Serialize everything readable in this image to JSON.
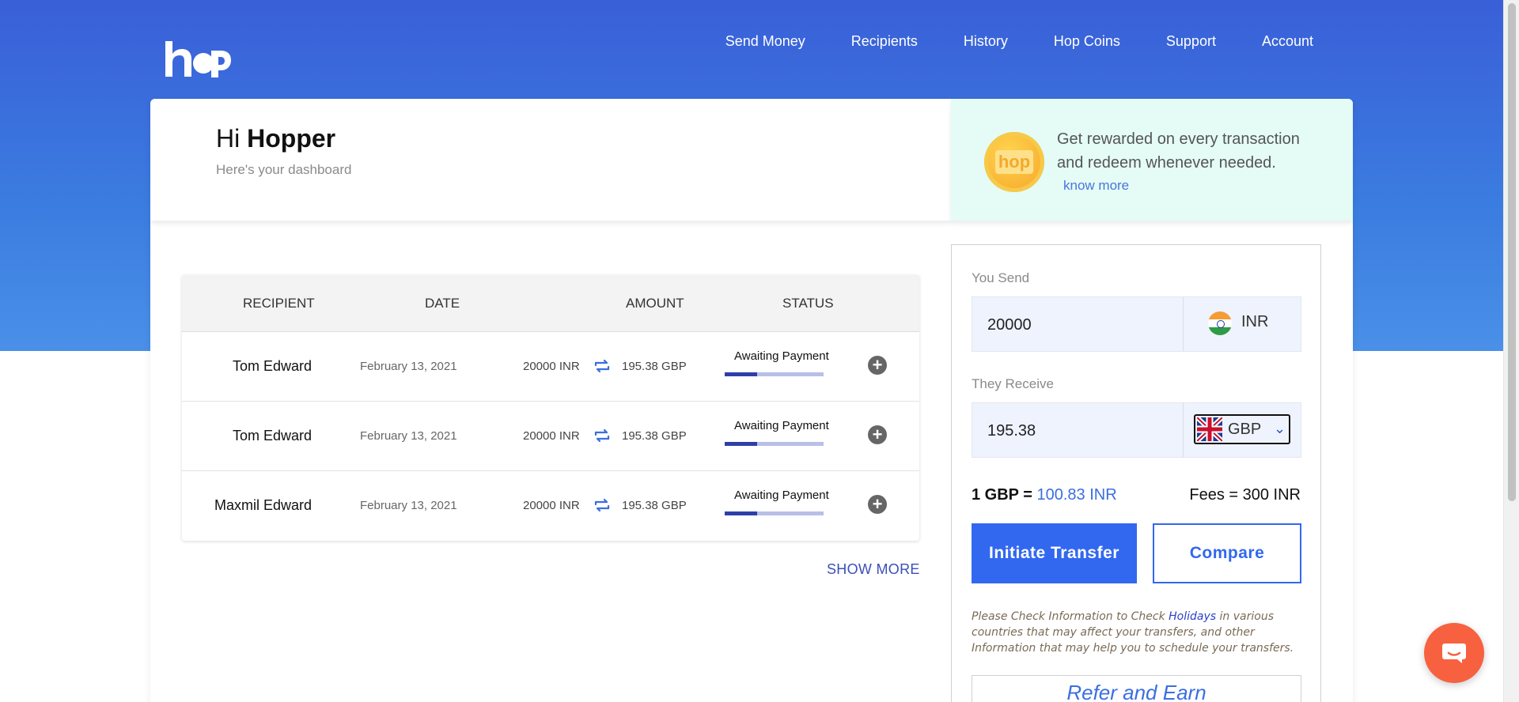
{
  "brand": {
    "logo_text": "hop"
  },
  "nav": {
    "items": [
      "Send Money",
      "Recipients",
      "History",
      "Hop Coins",
      "Support",
      "Account"
    ]
  },
  "greeting": {
    "hi": "Hi",
    "name": "Hopper",
    "subtitle": "Here's your dashboard"
  },
  "promo": {
    "coin_label": "hop",
    "text": "Get rewarded on every transaction and redeem whenever needed.",
    "link": "know more"
  },
  "table": {
    "headers": [
      "RECIPIENT",
      "DATE",
      "AMOUNT",
      "STATUS"
    ],
    "rows": [
      {
        "name": "Tom Edward",
        "date": "February 13, 2021",
        "send": "20000 INR",
        "receive": "195.38 GBP",
        "status": "Awaiting Payment",
        "progress": 0.33
      },
      {
        "name": "Tom Edward",
        "date": "February 13, 2021",
        "send": "20000 INR",
        "receive": "195.38 GBP",
        "status": "Awaiting Payment",
        "progress": 0.33
      },
      {
        "name": "Maxmil Edward",
        "date": "February 13, 2021",
        "send": "20000 INR",
        "receive": "195.38 GBP",
        "status": "Awaiting Payment",
        "progress": 0.33
      }
    ],
    "show_more": "SHOW MORE"
  },
  "calculator": {
    "send_label": "You Send",
    "send_value": "20000",
    "send_currency": "INR",
    "receive_label": "They Receive",
    "receive_value": "195.38",
    "receive_currency": "GBP",
    "rate_prefix": "1 GBP =",
    "rate_value": "100.83 INR",
    "fees": "Fees = 300 INR",
    "initiate_label": "Initiate Transfer",
    "compare_label": "Compare",
    "info_before": "Please Check Information to Check ",
    "info_link": "Holidays",
    "info_after": " in various countries that may affect your transfers, and other Information that may help you to schedule your transfers.",
    "refer_label": "Refer and Earn"
  },
  "colors": {
    "accent": "#3268f0",
    "hero": "#3a5fd8",
    "chat": "#f7613f"
  }
}
